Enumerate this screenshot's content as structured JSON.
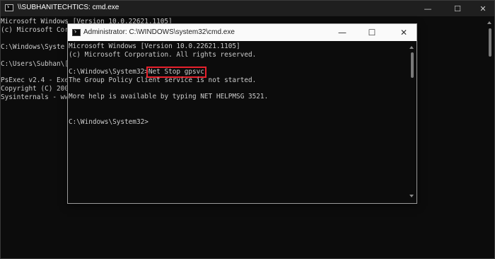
{
  "back_window": {
    "title": "\\\\SUBHANITECHTICS: cmd.exe",
    "controls": {
      "minimize": "—",
      "maximize": "☐",
      "close": "✕"
    },
    "lines": [
      "Microsoft Windows [Version 10.0.22621.1105]",
      "(c) Microsoft Cor",
      "",
      "C:\\Windows\\Syste",
      "",
      "C:\\Users\\Subhan\\[",
      "",
      "PsExec v2.4 - Exe",
      "Copyright (C) 200",
      "Sysinternals - ww"
    ]
  },
  "front_window": {
    "title": "Administrator: C:\\WINDOWS\\system32\\cmd.exe",
    "controls": {
      "minimize": "—",
      "maximize": "☐",
      "close": "✕"
    },
    "line1": "Microsoft Windows [Version 10.0.22621.1105]",
    "line2": "(c) Microsoft Corporation. All rights reserved.",
    "prompt": "C:\\Windows\\System32>",
    "command": "Net Stop gpsvc",
    "line5": "The Group Policy Client service is not started.",
    "line7": "More help is available by typing NET HELPMSG 3521.",
    "prompt2": "C:\\Windows\\System32>"
  },
  "colors": {
    "console_bg": "#0c0c0c",
    "console_text": "#cccccc",
    "highlight": "#e8212c"
  }
}
